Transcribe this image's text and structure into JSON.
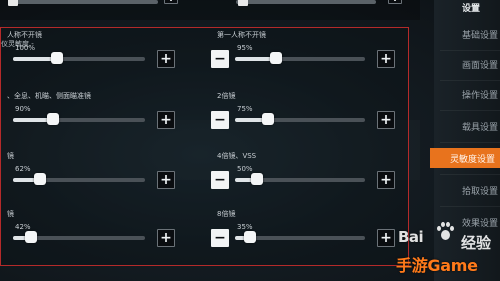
{
  "panel": {
    "title": "仪灵敏度 -"
  },
  "settings": [
    {
      "label": "人称不开镜",
      "value_text": "100%",
      "value": 100,
      "max": 300,
      "has_minus": false
    },
    {
      "label": "第一人称不开镜",
      "value_text": "95%",
      "value": 95,
      "max": 300,
      "has_minus": true
    },
    {
      "label": "、全息、机瞄、侧面瞄准镜",
      "value_text": "90%",
      "value": 90,
      "max": 300,
      "has_minus": false
    },
    {
      "label": "2倍镜",
      "value_text": "75%",
      "value": 75,
      "max": 300,
      "has_minus": true
    },
    {
      "label": "镜",
      "value_text": "62%",
      "value": 62,
      "max": 300,
      "has_minus": false
    },
    {
      "label": "4倍镜、VSS",
      "value_text": "50%",
      "value": 50,
      "max": 300,
      "has_minus": true
    },
    {
      "label": "镜",
      "value_text": "42%",
      "value": 42,
      "max": 300,
      "has_minus": false
    },
    {
      "label": "8倍镜",
      "value_text": "35%",
      "value": 35,
      "max": 300,
      "has_minus": true
    }
  ],
  "sidebar": {
    "header": "设置",
    "items": [
      {
        "label": "基础设置",
        "active": false
      },
      {
        "label": "画面设置",
        "active": false
      },
      {
        "label": "操作设置",
        "active": false
      },
      {
        "label": "载具设置",
        "active": false
      },
      {
        "label": "灵敏度设置",
        "active": true
      },
      {
        "label": "拾取设置",
        "active": false
      },
      {
        "label": "效果设置",
        "active": false
      }
    ]
  },
  "watermark": {
    "baidu": "Bai",
    "baidu_suffix": "经验",
    "site": "手游Game"
  },
  "colors": {
    "accent": "#e8731d",
    "panel_border": "#b42a2a",
    "watermark_orange": "#ff7a1a"
  }
}
